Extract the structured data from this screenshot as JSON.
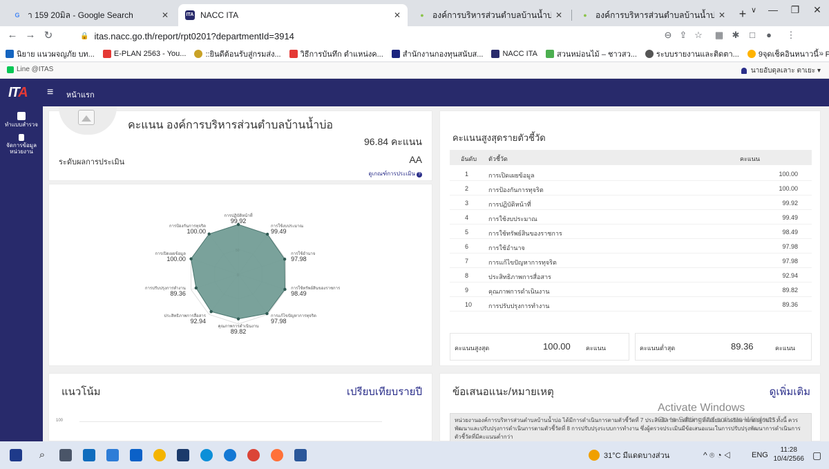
{
  "browser": {
    "tabs": [
      {
        "title": "า 159 20มิล - Google Search",
        "fav": "G",
        "fav_color": "#4285f4"
      },
      {
        "title": "NACC ITA",
        "fav": "ITA",
        "fav_color": "#282a6b"
      },
      {
        "title": "องค์การบริหารส่วนตำบลบ้านน้ำบ่อ หมู่",
        "fav": "●",
        "fav_color": "#8bc34a"
      },
      {
        "title": "องค์การบริหารส่วนตำบลบ้านน้ำบ่อ หมู่",
        "fav": "●",
        "fav_color": "#8bc34a"
      }
    ],
    "new_tab": "+",
    "url": "itas.nacc.go.th/report/rpt0201?departmentId=3914",
    "bookmarks": [
      {
        "label": "นิยาย แนวผจญภัย บท...",
        "color": "#1565c0"
      },
      {
        "label": "E-PLAN 2563 - You...",
        "color": "#e53935"
      },
      {
        "label": "::ยินดีต้อนรับสู่กรมส่ง...",
        "color": "#c9a227"
      },
      {
        "label": "วิธีการบันทึก ตำแหน่งค...",
        "color": "#e53935"
      },
      {
        "label": "สำนักงานกองทุนสนับส...",
        "color": "#1a237e"
      },
      {
        "label": "NACC ITA",
        "color": "#282a6b"
      },
      {
        "label": "สวนหม่อนไม้ – ชาวสว...",
        "color": "#4caf50"
      },
      {
        "label": "ระบบรายงานและติดตา...",
        "color": "#555555"
      },
      {
        "label": "9จุดเช็คอินหนาวนี้ - P...",
        "color": "#ffb300"
      }
    ]
  },
  "site": {
    "line_link": "Line @ITAS",
    "user": "นายอับดุลเลาะ ตาเยะ ▾",
    "logo_main": "IT",
    "logo_accent": "A",
    "home": "หน้าแรก",
    "sidebar": [
      {
        "label": "ทำแบบสำรวจ"
      },
      {
        "label": "จัดการข้อมูลหน่วยงาน"
      }
    ]
  },
  "score_card": {
    "title": "คะแนน องค์การบริหารส่วนตำบลบ้านน้ำบ่อ",
    "score": "96.84 คะแนน",
    "level_label": "ระดับผลการประเมิน",
    "level_value": "AA",
    "criteria_link": "ดูเกณฑ์การประเมิน",
    "radar": {
      "center_tick": "0",
      "mid_tick": "50",
      "labels": [
        {
          "label": "การปฏิบัติหน้าที่",
          "value": "99.92"
        },
        {
          "label": "การใช้งบประมาณ",
          "value": "99.49"
        },
        {
          "label": "การใช้อำนาจ",
          "value": "97.98"
        },
        {
          "label": "การใช้ทรัพย์สินของราชการ",
          "value": "98.49"
        },
        {
          "label": "การแก้ไขปัญหาการทุจริต",
          "value": "97.98"
        },
        {
          "label": "คุณภาพการดำเนินงาน",
          "value": "89.82"
        },
        {
          "label": "ประสิทธิภาพการสื่อสาร",
          "value": "92.94"
        },
        {
          "label": "การปรับปรุงการทำงาน",
          "value": "89.36"
        },
        {
          "label": "การเปิดเผยข้อมูล",
          "value": "100.00"
        },
        {
          "label": "การป้องกันการทุจริต",
          "value": "100.00"
        }
      ]
    }
  },
  "chart_data": {
    "type": "radar",
    "categories": [
      "การปฏิบัติหน้าที่",
      "การใช้งบประมาณ",
      "การใช้อำนาจ",
      "การใช้ทรัพย์สินของราชการ",
      "การแก้ไขปัญหาการทุจริต",
      "คุณภาพการดำเนินงาน",
      "ประสิทธิภาพการสื่อสาร",
      "การปรับปรุงการทำงาน",
      "การเปิดเผยข้อมูล",
      "การป้องกันการทุจริต"
    ],
    "values": [
      99.92,
      99.49,
      97.98,
      98.49,
      97.98,
      89.82,
      92.94,
      89.36,
      100.0,
      100.0
    ],
    "range": [
      0,
      100
    ],
    "ticks": [
      0,
      50
    ],
    "fill_color": "#6f9a93"
  },
  "ranking": {
    "title": "คะแนนสูงสุดรายตัวชี้วัด",
    "columns": [
      "อันดับ",
      "ตัวชี้วัด",
      "คะแนน"
    ],
    "rows": [
      {
        "rank": "1",
        "name": "การเปิดเผยข้อมูล",
        "score": "100.00"
      },
      {
        "rank": "2",
        "name": "การป้องกันการทุจริต",
        "score": "100.00"
      },
      {
        "rank": "3",
        "name": "การปฏิบัติหน้าที่",
        "score": "99.92"
      },
      {
        "rank": "4",
        "name": "การใช้งบประมาณ",
        "score": "99.49"
      },
      {
        "rank": "5",
        "name": "การใช้ทรัพย์สินของราชการ",
        "score": "98.49"
      },
      {
        "rank": "6",
        "name": "การใช้อำนาจ",
        "score": "97.98"
      },
      {
        "rank": "7",
        "name": "การแก้ไขปัญหาการทุจริต",
        "score": "97.98"
      },
      {
        "rank": "8",
        "name": "ประสิทธิภาพการสื่อสาร",
        "score": "92.94"
      },
      {
        "rank": "9",
        "name": "คุณภาพการดำเนินงาน",
        "score": "89.82"
      },
      {
        "rank": "10",
        "name": "การปรับปรุงการทำงาน",
        "score": "89.36"
      }
    ],
    "max_label": "คะแนนสูงสุด",
    "max_value": "100.00",
    "min_label": "คะแนนต่ำสุด",
    "min_value": "89.36",
    "unit": "คะแนน"
  },
  "trend": {
    "title": "แนวโน้ม",
    "compare_link": "เปรียบเทียบรายปี",
    "y_tick": "100"
  },
  "notes": {
    "title": "ข้อเสนอแนะ/หมายเหตุ",
    "more_link": "ดูเพิ่มเติม",
    "text": "หน่วยงานองค์การบริหารส่วนตำบลบ้านน้ำบ่อ ได้มีการดำเนินการตามตัวชี้วัดที่ 7 ประสิทธิภาพการสื่อสาร ที่ดีเยี่ยม ควรรักษามาตรฐานไว้ ทั้งนี้ ควรพัฒนาและปรับปรุงการดำเนินการตามตัวชี้วัดที่ 8 การปรับปรุงระบบการทำงาน ซึ่งผู้ตรวจประเมินมีข้อเสนอแนะในการปรับปรุงพัฒนาการดำเนินการตัวชี้วัดที่มีคะแนนต่ำกว่า"
  },
  "watermark": {
    "line1": "Activate Windows",
    "line2": "Go to Settings to activate Windows."
  },
  "taskbar": {
    "weather": "31°C มีแดดบางส่วน",
    "lang": "ENG",
    "time": "11:28",
    "date": "10/4/2566"
  }
}
